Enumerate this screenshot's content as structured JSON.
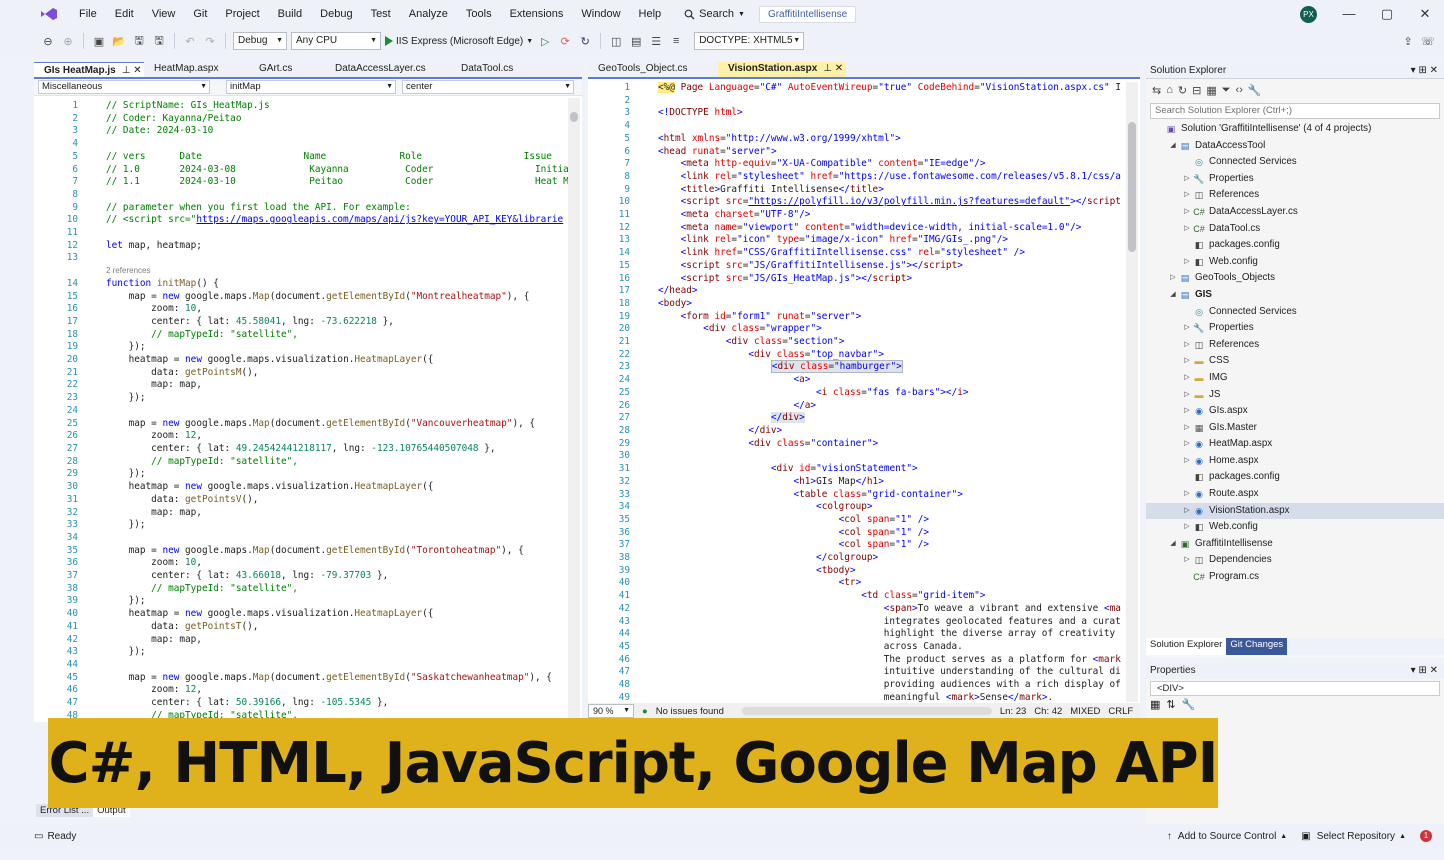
{
  "menu": [
    "File",
    "Edit",
    "View",
    "Git",
    "Project",
    "Build",
    "Debug",
    "Test",
    "Analyze",
    "Tools",
    "Extensions",
    "Window",
    "Help"
  ],
  "search_label": "Search",
  "project_name": "GraffitiIntellisense",
  "user_initials": "PX",
  "toolbar": {
    "config": "Debug",
    "platform": "Any CPU",
    "run_label": "IIS Express (Microsoft Edge)",
    "doctype": "DOCTYPE: XHTML5"
  },
  "left_editor": {
    "tabs": [
      "GIs HeatMap.js",
      "HeatMap.aspx",
      "GArt.cs",
      "DataAccessLayer.cs",
      "DataTool.cs"
    ],
    "nav": [
      "Miscellaneous",
      "initMap",
      "center"
    ],
    "zoom": "90"
  },
  "right_editor": {
    "tabs": [
      "GeoTools_Object.cs",
      "VisionStation.aspx"
    ],
    "zoom": "90 %",
    "issues": "No issues found",
    "ln": "Ln: 23",
    "ch": "Ch: 42",
    "mode": "MIXED",
    "eol": "CRLF"
  },
  "solution_explorer": {
    "title": "Solution Explorer",
    "search_placeholder": "Search Solution Explorer (Ctrl+;)",
    "tree": [
      {
        "d": 0,
        "t": "",
        "i": "sln",
        "label": "Solution 'GraffitiIntellisense' (4 of 4 projects)"
      },
      {
        "d": 1,
        "t": "open",
        "i": "proj",
        "label": "DataAccessTool"
      },
      {
        "d": 2,
        "t": "",
        "i": "svc",
        "label": "Connected Services"
      },
      {
        "d": 2,
        "t": "closed",
        "i": "wrench",
        "label": "Properties"
      },
      {
        "d": 2,
        "t": "closed",
        "i": "ref",
        "label": "References"
      },
      {
        "d": 2,
        "t": "closed",
        "i": "cs",
        "label": "DataAccessLayer.cs"
      },
      {
        "d": 2,
        "t": "closed",
        "i": "cs",
        "label": "DataTool.cs"
      },
      {
        "d": 2,
        "t": "",
        "i": "cfg",
        "label": "packages.config"
      },
      {
        "d": 2,
        "t": "closed",
        "i": "cfg",
        "label": "Web.config"
      },
      {
        "d": 1,
        "t": "closed",
        "i": "proj",
        "label": "GeoTools_Objects"
      },
      {
        "d": 1,
        "t": "open",
        "i": "proj",
        "label": "GIS",
        "bold": true
      },
      {
        "d": 2,
        "t": "",
        "i": "svc",
        "label": "Connected Services"
      },
      {
        "d": 2,
        "t": "closed",
        "i": "wrench",
        "label": "Properties"
      },
      {
        "d": 2,
        "t": "closed",
        "i": "ref",
        "label": "References"
      },
      {
        "d": 2,
        "t": "closed",
        "i": "folder",
        "label": "CSS"
      },
      {
        "d": 2,
        "t": "closed",
        "i": "folder",
        "label": "IMG"
      },
      {
        "d": 2,
        "t": "closed",
        "i": "folder",
        "label": "JS"
      },
      {
        "d": 2,
        "t": "closed",
        "i": "aspx",
        "label": "GIs.aspx"
      },
      {
        "d": 2,
        "t": "closed",
        "i": "master",
        "label": "GIs.Master"
      },
      {
        "d": 2,
        "t": "closed",
        "i": "aspx",
        "label": "HeatMap.aspx"
      },
      {
        "d": 2,
        "t": "closed",
        "i": "aspx",
        "label": "Home.aspx"
      },
      {
        "d": 2,
        "t": "",
        "i": "cfg",
        "label": "packages.config"
      },
      {
        "d": 2,
        "t": "closed",
        "i": "aspx",
        "label": "Route.aspx"
      },
      {
        "d": 2,
        "t": "closed",
        "i": "aspx",
        "label": "VisionStation.aspx",
        "sel": true
      },
      {
        "d": 2,
        "t": "closed",
        "i": "cfg",
        "label": "Web.config"
      },
      {
        "d": 1,
        "t": "open",
        "i": "csproj",
        "label": "GraffitiIntellisense"
      },
      {
        "d": 2,
        "t": "closed",
        "i": "ref",
        "label": "Dependencies"
      },
      {
        "d": 2,
        "t": "",
        "i": "cs",
        "label": "Program.cs"
      }
    ],
    "bottom_tabs": [
      "Solution Explorer",
      "Git Changes"
    ]
  },
  "properties": {
    "title": "Properties",
    "selected": "<DIV>"
  },
  "status": {
    "ready": "Ready",
    "source_control": "Add to Source Control",
    "repo": "Select Repository",
    "errors": "1"
  },
  "output_tabs": [
    "Error List ...",
    "Output"
  ],
  "banner": "C#, HTML, JavaScript, Google Map API",
  "colors": {
    "accent": "#5a7bd6",
    "banner": "#dfb21b",
    "active_tab": "#fdf0a8"
  }
}
